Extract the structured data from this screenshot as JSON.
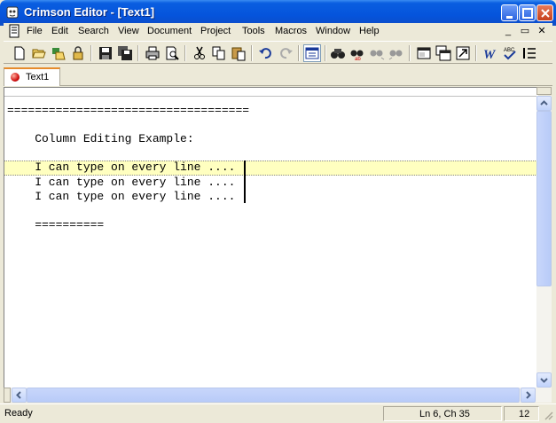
{
  "window": {
    "title": "Crimson Editor - [Text1]",
    "accent": "#0554dc",
    "icon": "crimson-editor-app-icon"
  },
  "menu": {
    "items": [
      "File",
      "Edit",
      "Search",
      "View",
      "Document",
      "Project",
      "Tools",
      "Macros",
      "Window",
      "Help"
    ]
  },
  "toolbar": {
    "icons": [
      "new-file-icon",
      "open-folder-icon",
      "open-remote-icon",
      "lock-icon",
      "save-icon",
      "save-all-icon",
      "print-icon",
      "print-preview-icon",
      "cut-icon",
      "copy-icon",
      "paste-icon",
      "undo-icon",
      "redo-icon",
      "column-mode-icon",
      "find-icon",
      "replace-icon",
      "find-next-icon",
      "find-prev-icon",
      "window-icon",
      "windows-icon",
      "goto-icon",
      "word-wrap-icon",
      "spell-check-icon",
      "line-numbers-icon"
    ]
  },
  "tabs": [
    {
      "label": "Text1",
      "active": true
    }
  ],
  "editor": {
    "lines": [
      "===================================",
      "",
      "    Column Editing Example:",
      "",
      "    I can type on every line ....",
      "    I can type on every line ....",
      "    I can type on every line ....",
      "",
      "    =========="
    ],
    "current_line_index": 4,
    "current_line_color": "#ffffc0"
  },
  "status": {
    "ready": "Ready",
    "position": "Ln 6, Ch 35",
    "pane3": "12"
  }
}
